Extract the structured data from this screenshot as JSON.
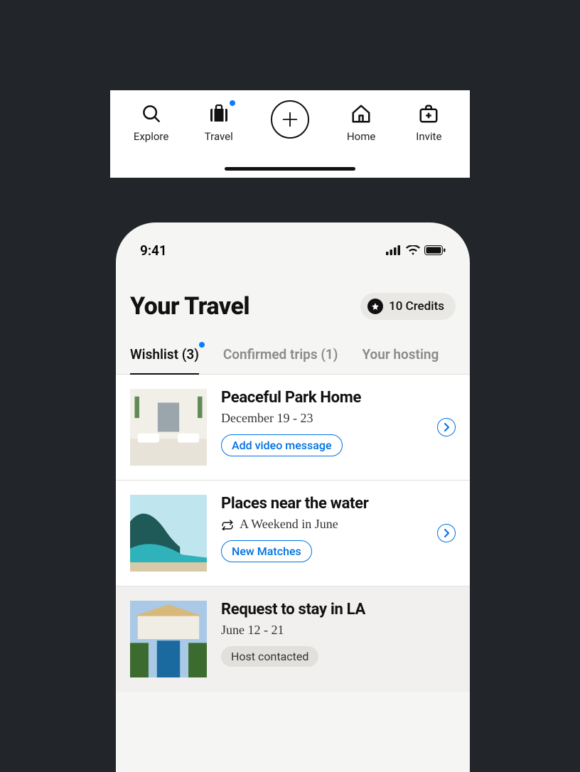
{
  "tabbar": {
    "items": [
      {
        "label": "Explore"
      },
      {
        "label": "Travel"
      },
      {
        "label": "Home"
      },
      {
        "label": "Invite"
      }
    ]
  },
  "status": {
    "time": "9:41"
  },
  "header": {
    "title": "Your Travel",
    "credits": "10 Credits"
  },
  "tabs": [
    {
      "label": "Wishlist (3)"
    },
    {
      "label": "Confirmed trips (1)"
    },
    {
      "label": "Your hosting"
    }
  ],
  "list": [
    {
      "title": "Peaceful Park Home",
      "subtitle": "December 19 - 23",
      "chip": "Add video message"
    },
    {
      "title": "Places near the water",
      "subtitle": "A Weekend in June",
      "chip": "New Matches"
    },
    {
      "title": "Request to stay in LA",
      "subtitle": "June 12 - 21",
      "chip": "Host contacted"
    }
  ]
}
